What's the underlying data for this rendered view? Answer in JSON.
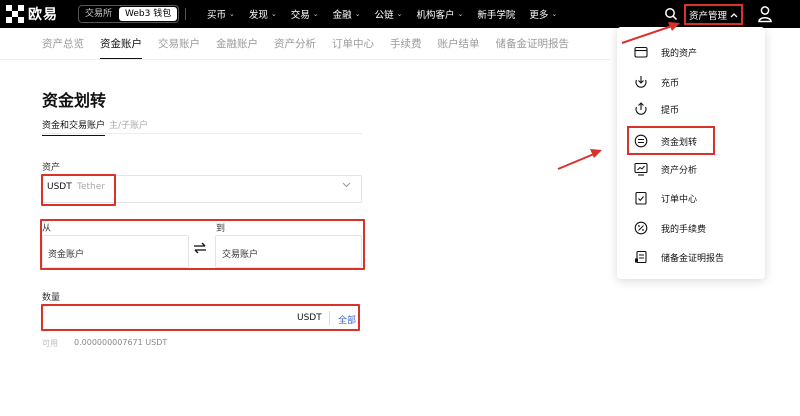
{
  "topbar": {
    "logo_text": "欧易",
    "mode_exchange": "交易所",
    "mode_web3": "Web3 钱包",
    "nav": [
      "买币",
      "发现",
      "交易",
      "金融",
      "公链",
      "机构客户",
      "新手学院",
      "更多"
    ],
    "nav_has_chevron": [
      true,
      true,
      true,
      true,
      true,
      true,
      false,
      true
    ],
    "asset_management": "资产管理"
  },
  "subnav": {
    "items": [
      "资产总览",
      "资金账户",
      "交易账户",
      "金融账户",
      "资产分析",
      "订单中心",
      "手续费",
      "账户结单",
      "储备金证明报告"
    ],
    "active_index": 1
  },
  "page": {
    "title": "资金划转",
    "tabs": [
      "资金和交易账户",
      "主/子账户"
    ],
    "active_tab": 0,
    "asset_label": "资产",
    "coin_code": "USDT",
    "coin_name": "Tether",
    "from_label": "从",
    "to_label": "到",
    "from_account": "资金账户",
    "to_account": "交易账户",
    "amount_label": "数量",
    "amount_unit": "USDT",
    "amount_all": "全部",
    "available_label": "可用",
    "available_value": "0.000000007671 USDT"
  },
  "dropdown": {
    "items": [
      {
        "label": "我的资产",
        "icon": "wallet-icon"
      },
      {
        "label": "充币",
        "icon": "deposit-icon"
      },
      {
        "label": "提币",
        "icon": "withdraw-icon"
      },
      {
        "label": "资金划转",
        "icon": "transfer-icon"
      },
      {
        "label": "资产分析",
        "icon": "analysis-icon"
      },
      {
        "label": "订单中心",
        "icon": "order-center-icon"
      },
      {
        "label": "我的手续费",
        "icon": "fee-icon"
      },
      {
        "label": "储备金证明报告",
        "icon": "reserve-report-icon"
      }
    ],
    "highlighted_index": 3
  },
  "colors": {
    "highlight": "#d9322a",
    "link": "#3b66d6",
    "topbar_bg": "#000000"
  }
}
